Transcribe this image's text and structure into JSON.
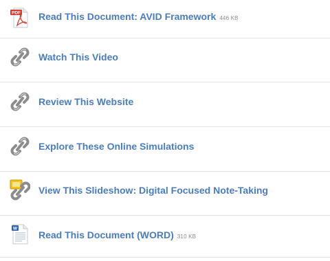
{
  "resources": [
    {
      "icon": "pdf-file-icon",
      "label": "Read This Document: AVID Framework",
      "size": "446 KB"
    },
    {
      "icon": "link-icon",
      "label": "Watch This Video",
      "size": ""
    },
    {
      "icon": "link-icon",
      "label": "Review This Website",
      "size": ""
    },
    {
      "icon": "link-icon",
      "label": "Explore These Online Simulations",
      "size": ""
    },
    {
      "icon": "slideshow-link-icon",
      "label": "View This Slideshow: Digital Focused Note-Taking",
      "size": ""
    },
    {
      "icon": "word-file-icon",
      "label": "Read This Document (WORD)",
      "size": "310 KB"
    }
  ],
  "pdf_icon_text": "PDF",
  "word_icon_text": "W",
  "colors": {
    "link_text": "#4a7cc2",
    "size_text": "#8a8a8a",
    "divider": "#e3e3e3",
    "pdf_red": "#d83a2e",
    "chain_gray": "#8c8c8c",
    "slide_yellow": "#f2c318",
    "word_blue": "#2f63b5"
  }
}
